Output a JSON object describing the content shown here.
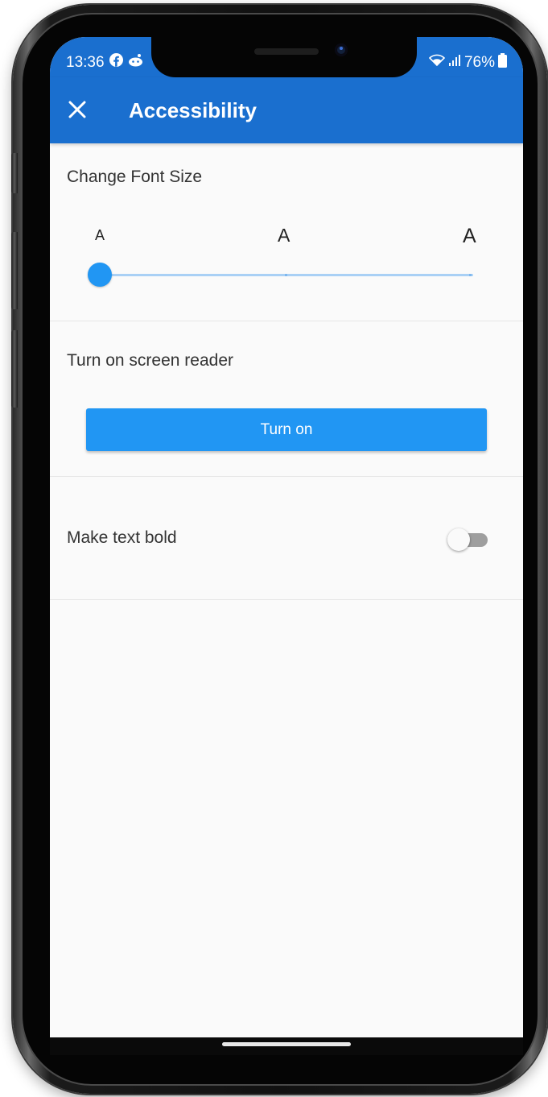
{
  "status_bar": {
    "time": "13:36",
    "left_icons": [
      "facebook-icon",
      "reddit-icon"
    ],
    "battery": "76%",
    "right_icons": [
      "wifi-icon",
      "signal-icon",
      "battery-icon"
    ]
  },
  "app_bar": {
    "close_icon": "close-icon",
    "title": "Accessibility",
    "background_color": "#1a6fcf"
  },
  "font_size": {
    "title": "Change Font Size",
    "labels": [
      "A",
      "A",
      "A"
    ],
    "selected_index": 0,
    "accent_color": "#2196f3"
  },
  "screen_reader": {
    "title": "Turn on screen reader",
    "button_label": "Turn on"
  },
  "bold_text": {
    "title": "Make text bold",
    "enabled": false
  }
}
